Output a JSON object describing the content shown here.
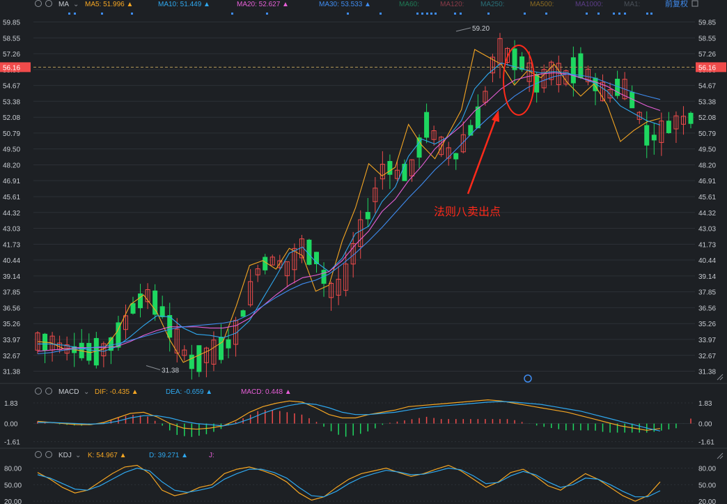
{
  "header": {
    "indicator": "MA",
    "ma_items": [
      {
        "label": "MA5: 51.996",
        "color": "#f5a623",
        "arrow": "▲"
      },
      {
        "label": "MA10: 51.449",
        "color": "#2fa8ef",
        "arrow": "▲"
      },
      {
        "label": "MA20: 52.627",
        "color": "#e75fd8",
        "arrow": "▲"
      },
      {
        "label": "MA30: 53.533",
        "color": "#3f8cf0",
        "arrow": "▲"
      },
      {
        "label": "MA60:",
        "color": "#1f7a55",
        "arrow": ""
      },
      {
        "label": "MA120:",
        "color": "#8a3b48",
        "arrow": ""
      },
      {
        "label": "MA250:",
        "color": "#2a6f78",
        "arrow": ""
      },
      {
        "label": "MA500:",
        "color": "#8a6a22",
        "arrow": ""
      },
      {
        "label": "MA1000:",
        "color": "#5b3d86",
        "arrow": ""
      },
      {
        "label": "MA1:",
        "color": "#4a5058",
        "arrow": ""
      }
    ],
    "fq_label": "前复权"
  },
  "colors": {
    "background": "#1d2024",
    "up": "#f04b4b",
    "down": "#1ed760",
    "text": "#c8ccd2",
    "grid": "#2c3036",
    "current_price": "#f04b4b",
    "annotation": "#ff2a1a"
  },
  "chart_data": {
    "type": "candlestick",
    "price_axis_ticks": [
      "59.85",
      "58.55",
      "57.26",
      "55.96",
      "54.67",
      "53.38",
      "52.08",
      "50.79",
      "49.50",
      "48.20",
      "46.91",
      "45.61",
      "44.32",
      "43.03",
      "41.73",
      "40.44",
      "39.14",
      "37.85",
      "36.56",
      "35.26",
      "33.97",
      "32.67",
      "31.38"
    ],
    "y_range": [
      30.5,
      60.5
    ],
    "current_price": "56.16",
    "high_label": "59.20",
    "low_label": "31.38",
    "annotation": "法则八卖出点",
    "ma_lines": [
      {
        "name": "MA5",
        "color": "#f5a623",
        "values": [
          33.8,
          33.7,
          33.2,
          33.1,
          32.9,
          33.2,
          34.6,
          36.8,
          37.6,
          36.2,
          33.9,
          32.1,
          32.6,
          33.1,
          33.8,
          36.7,
          40.0,
          40.4,
          39.7,
          41.4,
          40.8,
          37.9,
          38.4,
          42.0,
          44.7,
          48.3,
          47.3,
          48.0,
          51.5,
          49.8,
          48.7,
          50.7,
          52.7,
          57.6,
          57.0,
          56.4,
          54.7,
          55.9,
          55.3,
          56.4,
          54.9,
          53.8,
          54.8,
          53.1,
          50.1,
          51.0,
          51.7,
          51.99
        ]
      },
      {
        "name": "MA10",
        "color": "#2fa8ef",
        "values": [
          33.6,
          33.6,
          33.5,
          33.3,
          33.1,
          33.0,
          33.4,
          34.2,
          35.1,
          35.9,
          35.8,
          34.9,
          34.4,
          34.3,
          34.1,
          34.5,
          35.5,
          37.3,
          39.1,
          41.0,
          41.5,
          40.3,
          39.5,
          40.6,
          42.6,
          43.2,
          45.2,
          46.4,
          48.9,
          50.3,
          49.9,
          50.5,
          51.8,
          54.4,
          55.6,
          56.5,
          56.2,
          55.9,
          55.7,
          55.8,
          55.7,
          55.3,
          54.9,
          54.2,
          53.0,
          52.4,
          51.8,
          51.45
        ]
      },
      {
        "name": "MA20",
        "color": "#e75fd8",
        "values": [
          33.0,
          33.1,
          33.2,
          33.3,
          33.3,
          33.3,
          33.4,
          33.8,
          34.3,
          34.7,
          35.0,
          35.0,
          35.0,
          34.9,
          34.9,
          35.1,
          35.7,
          36.7,
          37.6,
          38.4,
          39.0,
          39.2,
          39.5,
          40.4,
          41.7,
          42.8,
          44.4,
          45.4,
          46.9,
          48.1,
          49.5,
          50.5,
          51.4,
          52.6,
          53.4,
          54.4,
          55.1,
          55.4,
          55.6,
          55.7,
          55.6,
          55.3,
          55.0,
          54.6,
          54.0,
          53.5,
          53.0,
          52.63
        ]
      },
      {
        "name": "MA30",
        "color": "#3f8cf0",
        "values": [
          32.8,
          32.9,
          33.1,
          33.2,
          33.3,
          33.4,
          33.6,
          33.9,
          34.2,
          34.5,
          34.8,
          35.0,
          35.1,
          35.2,
          35.3,
          35.5,
          36.0,
          36.7,
          37.4,
          38.0,
          38.5,
          38.8,
          39.3,
          40.1,
          41.0,
          42.0,
          43.1,
          44.3,
          45.5,
          46.6,
          47.8,
          48.8,
          49.9,
          51.0,
          52.0,
          52.9,
          53.8,
          54.5,
          55.0,
          55.4,
          55.6,
          55.5,
          55.3,
          54.9,
          54.5,
          54.1,
          53.8,
          53.53
        ]
      }
    ],
    "macd": {
      "title": "MACD",
      "items": [
        {
          "label": "DIF: -0.435",
          "color": "#f5a623",
          "arrow": "▲"
        },
        {
          "label": "DEA: -0.659",
          "color": "#2fa8ef",
          "arrow": "▲"
        },
        {
          "label": "MACD: 0.448",
          "color": "#e75fd8",
          "arrow": "▲"
        }
      ],
      "ticks": [
        "1.83",
        "0.00",
        "-1.61"
      ],
      "y_range": [
        -2.0,
        2.2
      ],
      "dif": [
        0.2,
        0.1,
        0.0,
        -0.1,
        -0.1,
        0.1,
        0.5,
        0.9,
        1.0,
        0.6,
        0.0,
        -0.4,
        -0.5,
        -0.4,
        -0.2,
        0.3,
        1.0,
        1.5,
        1.8,
        2.0,
        1.9,
        1.4,
        0.8,
        0.5,
        0.5,
        0.8,
        1.0,
        1.2,
        1.5,
        1.6,
        1.7,
        1.8,
        1.9,
        2.0,
        2.1,
        2.0,
        1.8,
        1.6,
        1.4,
        1.2,
        1.0,
        0.7,
        0.4,
        0.1,
        -0.2,
        -0.4,
        -0.6,
        -0.44
      ],
      "dea": [
        0.1,
        0.1,
        0.05,
        0.0,
        -0.05,
        0.0,
        0.2,
        0.5,
        0.7,
        0.7,
        0.5,
        0.2,
        0.0,
        -0.1,
        -0.2,
        0.0,
        0.4,
        0.9,
        1.3,
        1.6,
        1.8,
        1.7,
        1.4,
        1.0,
        0.8,
        0.8,
        0.9,
        1.0,
        1.2,
        1.4,
        1.5,
        1.6,
        1.7,
        1.8,
        1.9,
        1.95,
        1.9,
        1.8,
        1.7,
        1.5,
        1.3,
        1.1,
        0.8,
        0.5,
        0.2,
        -0.1,
        -0.4,
        -0.66
      ]
    },
    "kdj": {
      "title": "KDJ",
      "items": [
        {
          "label": "K: 54.967",
          "color": "#f5a623",
          "arrow": "▲"
        },
        {
          "label": "D: 39.271",
          "color": "#2fa8ef",
          "arrow": "▲"
        },
        {
          "label": "J:",
          "color": "#e75fd8",
          "arrow": ""
        }
      ],
      "ticks": [
        "80.00",
        "50.00",
        "20.00"
      ],
      "y_range": [
        15,
        92
      ],
      "k": [
        72,
        60,
        45,
        35,
        40,
        55,
        70,
        82,
        85,
        70,
        40,
        30,
        35,
        45,
        50,
        70,
        78,
        82,
        76,
        68,
        55,
        35,
        22,
        28,
        45,
        60,
        70,
        75,
        80,
        72,
        65,
        70,
        78,
        85,
        75,
        60,
        45,
        55,
        72,
        78,
        65,
        48,
        40,
        55,
        70,
        60,
        45,
        30,
        20,
        30,
        55
      ],
      "d": [
        68,
        62,
        52,
        42,
        40,
        48,
        60,
        72,
        80,
        75,
        55,
        40,
        36,
        40,
        45,
        60,
        70,
        78,
        78,
        72,
        62,
        45,
        30,
        28,
        38,
        52,
        63,
        70,
        76,
        73,
        68,
        69,
        74,
        80,
        77,
        66,
        52,
        54,
        66,
        74,
        68,
        55,
        45,
        50,
        62,
        60,
        50,
        38,
        28,
        28,
        39
      ]
    }
  }
}
